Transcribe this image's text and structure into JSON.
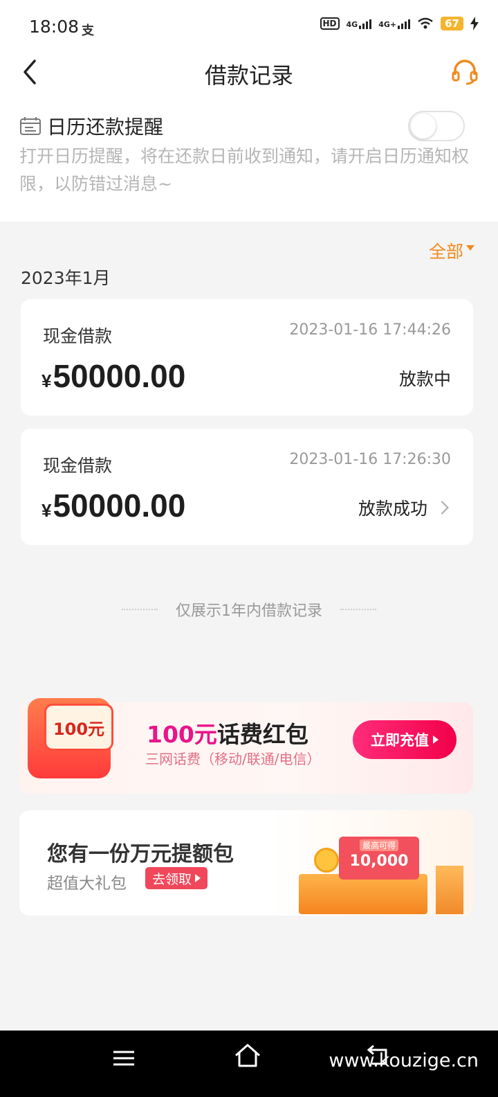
{
  "status_bar": {
    "time": "18:08",
    "extra_glyph": "支",
    "hd_label": "HD",
    "net1": "4G",
    "net2": "4G+",
    "battery": "67"
  },
  "header": {
    "title": "借款记录"
  },
  "calendar_reminder": {
    "title": "日历还款提醒",
    "description": "打开日历提醒，将在还款日前收到通知，请开启日历通知权限，以防错过消息~",
    "enabled": false
  },
  "filter": {
    "label": "全部"
  },
  "month_group": "2023年1月",
  "records": [
    {
      "type": "现金借款",
      "time": "2023-01-16 17:44:26",
      "currency": "¥",
      "amount": "50000.00",
      "status": "放款中"
    },
    {
      "type": "现金借款",
      "time": "2023-01-16 17:26:30",
      "currency": "¥",
      "amount": "50000.00",
      "status": "放款成功"
    }
  ],
  "footer_note": "仅展示1年内借款记录",
  "promo1": {
    "badge": "100元",
    "title_highlight": "100元",
    "title_rest": "话费红包",
    "subtitle": "三网话费（移动/联通/电信）",
    "button": "立即充值"
  },
  "promo2": {
    "title": "您有一份万元提额包",
    "subtitle": "超值大礼包",
    "button": "去领取",
    "ticket_small": "最高可得",
    "ticket_big": "10,000"
  },
  "watermark": "www.kouzige.cn",
  "colors": {
    "accent_orange": "#ef8a1c",
    "promo_pink": "#e8158a",
    "button_red": "#f0475a"
  }
}
